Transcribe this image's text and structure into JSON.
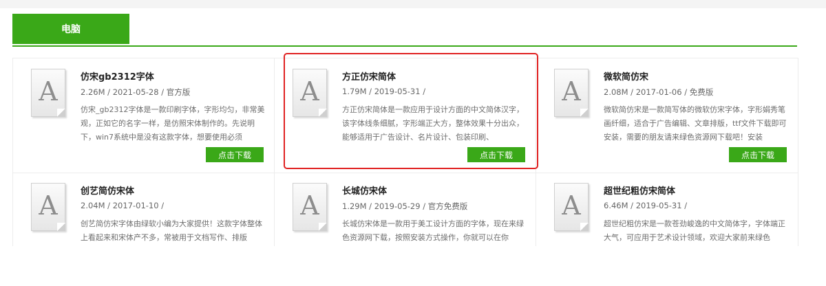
{
  "tab": {
    "label": "电脑"
  },
  "download_label": "点击下载",
  "fonts": [
    {
      "icon_letter": "A",
      "name": "仿宋gb2312字体",
      "meta": "2.26M / 2021-05-28 / 官方版",
      "desc": "仿宋_gb2312字体是一款印刷字体，字形均匀，非常美观，正如它的名字一样，是仿照宋体制作的。先说明下，win7系统中是没有这款字体，想要使用必须"
    },
    {
      "icon_letter": "A",
      "name": "方正仿宋简体",
      "meta": "1.79M / 2019-05-31 /",
      "desc": "方正仿宋简体是一款应用于设计方面的中文简体汉字，该字体线条细腻，字形端正大方，整体效果十分出众，能够适用于广告设计、名片设计、包装印刷、"
    },
    {
      "icon_letter": "A",
      "name": "微软简仿宋",
      "meta": "2.08M / 2017-01-06 / 免费版",
      "desc": "微软简仿宋是一款简写体的微软仿宋字体，字形娟秀笔画纤细，适合于广告编辑、文章排版，ttf文件下载即可安装，需要的朋友请来绿色资源网下载吧！安装"
    },
    {
      "icon_letter": "A",
      "name": "创艺简仿宋体",
      "meta": "2.04M / 2017-01-10 /",
      "desc": "创艺简仿宋字体由绿软小编为大家提供！这款字体整体上看起来和宋体产不多，常被用于文档写作、排版"
    },
    {
      "icon_letter": "A",
      "name": "长城仿宋体",
      "meta": "1.29M / 2019-05-29 / 官方免费版",
      "desc": "长城仿宋体是一款用于美工设计方面的字体，现在来绿色资源网下载，按照安装方式操作，你就可以在你"
    },
    {
      "icon_letter": "A",
      "name": "超世纪粗仿宋简体",
      "meta": "6.46M / 2019-05-31 /",
      "desc": "超世纪粗仿宋是一款苍劲峻逸的中文简体字，字体端正大气，可应用于艺术设计领域，欢迎大家前来绿色"
    }
  ],
  "colors": {
    "accent": "#3aa818",
    "highlight": "#e02020"
  }
}
